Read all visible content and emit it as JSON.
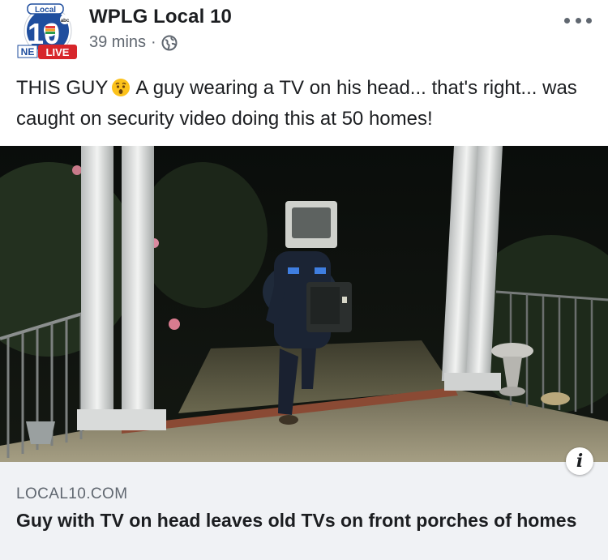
{
  "post": {
    "page_name": "WPLG Local 10",
    "time_ago": "39 mins",
    "separator": "·",
    "audience_icon": "globe-icon",
    "more_icon": "more-dots-icon",
    "text_before_emoji": "THIS GUY",
    "emoji": "astonished-face-emoji",
    "text_after_emoji": "A guy wearing a TV on his head... that's right... was caught on security video doing this at 50 homes!"
  },
  "avatar": {
    "logo_top_text": "Local",
    "logo_number": "10",
    "logo_network": "abc",
    "logo_left_text": "NE",
    "live_badge": "LIVE",
    "brand_color": "#1f4e9e",
    "live_color": "#d7262b"
  },
  "link_card": {
    "domain": "LOCAL10.COM",
    "title": "Guy with TV on head leaves old TVs on front porches of homes",
    "info_icon": "i"
  },
  "colors": {
    "text_primary": "#1c1e21",
    "text_secondary": "#606770",
    "card_bg": "#f0f2f5"
  }
}
